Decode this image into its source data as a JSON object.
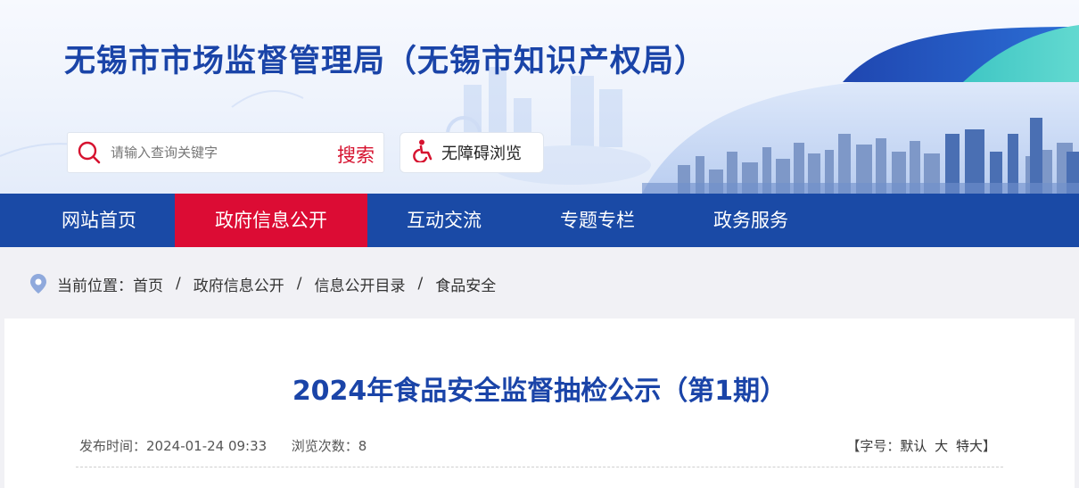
{
  "site": {
    "title": "无锡市市场监督管理局（无锡市知识产权局）"
  },
  "search": {
    "placeholder": "请输入查询关键字",
    "button_label": "搜索"
  },
  "accessibility": {
    "label": "无障碍浏览"
  },
  "nav": {
    "items": [
      {
        "label": "网站首页",
        "active": false
      },
      {
        "label": "政府信息公开",
        "active": true
      },
      {
        "label": "互动交流",
        "active": false
      },
      {
        "label": "专题专栏",
        "active": false
      },
      {
        "label": "政务服务",
        "active": false
      }
    ]
  },
  "breadcrumb": {
    "prefix": "当前位置：",
    "items": [
      "首页",
      "政府信息公开",
      "信息公开目录",
      "食品安全"
    ],
    "separator": "/"
  },
  "article": {
    "title": "2024年食品安全监督抽检公示（第1期）",
    "publish_label": "发布时间：",
    "publish_time": "2024-01-24 09:33",
    "views_label": "浏览次数：",
    "views": "8",
    "font_size_prefix": "【字号：",
    "font_default": "默认",
    "font_large": "大",
    "font_xlarge": "特大",
    "font_size_suffix": "】"
  },
  "colors": {
    "brand_blue": "#1a4aa6",
    "active_red": "#dc0c34",
    "title_blue": "#1a44a8",
    "search_red": "#d6122f"
  },
  "icons": [
    "search-icon",
    "wheelchair-icon",
    "location-pin-icon"
  ]
}
